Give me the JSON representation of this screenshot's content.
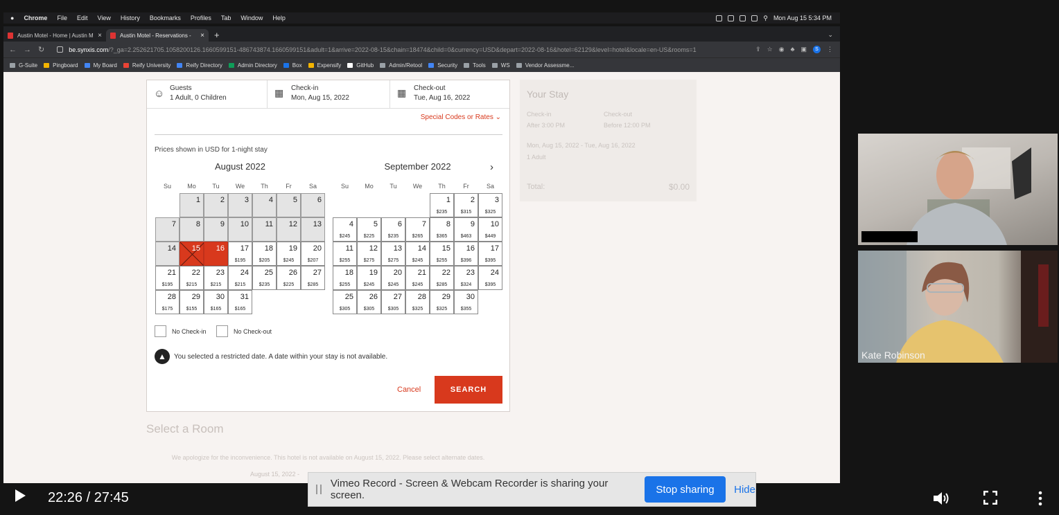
{
  "menubar": {
    "items": [
      "Chrome",
      "File",
      "Edit",
      "View",
      "History",
      "Bookmarks",
      "Profiles",
      "Tab",
      "Window",
      "Help"
    ],
    "clock": "Mon Aug 15  5:34 PM"
  },
  "tabs": [
    {
      "title": "Austin Motel - Home | Austin M"
    },
    {
      "title": "Austin Motel - Reservations - "
    }
  ],
  "address": {
    "domain": "be.synxis.com",
    "path": "/?_ga=2.252621705.1058200126.1660599151-486743874.1660599151&adult=1&arrive=2022-08-15&chain=18474&child=0&currency=USD&depart=2022-08-16&hotel=62129&level=hotel&locale=en-US&rooms=1"
  },
  "bookmarks": [
    "G-Suite",
    "Pingboard",
    "My Board",
    "Reify University",
    "Reify Directory",
    "Admin Directory",
    "Box",
    "Expensify",
    "GitHub",
    "Admin/Retool",
    "Security",
    "Tools",
    "WS",
    "Vendor Assessme..."
  ],
  "booking": {
    "guests_label": "Guests",
    "guests_value": "1 Adult, 0 Children",
    "checkin_label": "Check-in",
    "checkin_value": "Mon, Aug 15, 2022",
    "checkout_label": "Check-out",
    "checkout_value": "Tue, Aug 16, 2022",
    "special_codes": "Special Codes or Rates",
    "prices_note": "Prices shown in USD for 1-night stay",
    "weekdays": [
      "Su",
      "Mo",
      "Tu",
      "We",
      "Th",
      "Fr",
      "Sa"
    ],
    "months": [
      {
        "title": "August 2022",
        "first_weekday": 1,
        "days": [
          {
            "d": "1",
            "p": "",
            "s": "grey"
          },
          {
            "d": "2",
            "p": "",
            "s": "grey"
          },
          {
            "d": "3",
            "p": "",
            "s": "grey"
          },
          {
            "d": "4",
            "p": "",
            "s": "grey"
          },
          {
            "d": "5",
            "p": "",
            "s": "grey"
          },
          {
            "d": "6",
            "p": "",
            "s": "grey"
          },
          {
            "d": "7",
            "p": "",
            "s": "grey"
          },
          {
            "d": "8",
            "p": "",
            "s": "grey"
          },
          {
            "d": "9",
            "p": "",
            "s": "grey"
          },
          {
            "d": "10",
            "p": "",
            "s": "grey"
          },
          {
            "d": "11",
            "p": "",
            "s": "grey"
          },
          {
            "d": "12",
            "p": "",
            "s": "grey"
          },
          {
            "d": "13",
            "p": "",
            "s": "grey"
          },
          {
            "d": "14",
            "p": "",
            "s": "grey"
          },
          {
            "d": "15",
            "p": "",
            "s": "sel-x"
          },
          {
            "d": "16",
            "p": "",
            "s": "sel"
          },
          {
            "d": "17",
            "p": "$195",
            "s": ""
          },
          {
            "d": "18",
            "p": "$205",
            "s": ""
          },
          {
            "d": "19",
            "p": "$245",
            "s": ""
          },
          {
            "d": "20",
            "p": "$207",
            "s": ""
          },
          {
            "d": "21",
            "p": "$195",
            "s": ""
          },
          {
            "d": "22",
            "p": "$215",
            "s": ""
          },
          {
            "d": "23",
            "p": "$215",
            "s": ""
          },
          {
            "d": "24",
            "p": "$215",
            "s": ""
          },
          {
            "d": "25",
            "p": "$235",
            "s": ""
          },
          {
            "d": "26",
            "p": "$225",
            "s": ""
          },
          {
            "d": "27",
            "p": "$285",
            "s": ""
          },
          {
            "d": "28",
            "p": "$175",
            "s": ""
          },
          {
            "d": "29",
            "p": "$155",
            "s": ""
          },
          {
            "d": "30",
            "p": "$165",
            "s": ""
          },
          {
            "d": "31",
            "p": "$165",
            "s": ""
          }
        ]
      },
      {
        "title": "September 2022",
        "first_weekday": 4,
        "days": [
          {
            "d": "1",
            "p": "$235",
            "s": ""
          },
          {
            "d": "2",
            "p": "$315",
            "s": ""
          },
          {
            "d": "3",
            "p": "$325",
            "s": ""
          },
          {
            "d": "4",
            "p": "$245",
            "s": ""
          },
          {
            "d": "5",
            "p": "$225",
            "s": ""
          },
          {
            "d": "6",
            "p": "$235",
            "s": ""
          },
          {
            "d": "7",
            "p": "$265",
            "s": ""
          },
          {
            "d": "8",
            "p": "$365",
            "s": ""
          },
          {
            "d": "9",
            "p": "$463",
            "s": ""
          },
          {
            "d": "10",
            "p": "$449",
            "s": ""
          },
          {
            "d": "11",
            "p": "$255",
            "s": ""
          },
          {
            "d": "12",
            "p": "$275",
            "s": ""
          },
          {
            "d": "13",
            "p": "$275",
            "s": ""
          },
          {
            "d": "14",
            "p": "$245",
            "s": ""
          },
          {
            "d": "15",
            "p": "$255",
            "s": ""
          },
          {
            "d": "16",
            "p": "$396",
            "s": ""
          },
          {
            "d": "17",
            "p": "$395",
            "s": ""
          },
          {
            "d": "18",
            "p": "$255",
            "s": ""
          },
          {
            "d": "19",
            "p": "$245",
            "s": ""
          },
          {
            "d": "20",
            "p": "$245",
            "s": ""
          },
          {
            "d": "21",
            "p": "$245",
            "s": ""
          },
          {
            "d": "22",
            "p": "$285",
            "s": ""
          },
          {
            "d": "23",
            "p": "$324",
            "s": ""
          },
          {
            "d": "24",
            "p": "$395",
            "s": ""
          },
          {
            "d": "25",
            "p": "$305",
            "s": ""
          },
          {
            "d": "26",
            "p": "$305",
            "s": ""
          },
          {
            "d": "27",
            "p": "$305",
            "s": ""
          },
          {
            "d": "28",
            "p": "$325",
            "s": ""
          },
          {
            "d": "29",
            "p": "$325",
            "s": ""
          },
          {
            "d": "30",
            "p": "$355",
            "s": ""
          }
        ]
      }
    ],
    "no_checkin": "No Check-in",
    "no_checkout": "No Check-out",
    "warning": "You selected a restricted date.  A date within your stay is not available.",
    "cancel": "Cancel",
    "search": "SEARCH",
    "accent_color": "#d8391d"
  },
  "your_stay": {
    "title": "Your Stay",
    "checkin_label": "Check-in",
    "checkin_time": "After 3:00 PM",
    "checkout_label": "Check-out",
    "checkout_time": "Before 12:00 PM",
    "dates": "Mon, Aug 15, 2022 - Tue, Aug 16, 2022",
    "guests": "1 Adult",
    "total_label": "Total:",
    "total_value": "$0.00"
  },
  "select_room": {
    "title": "Select a Room",
    "apology": "We apologize for the inconvenience. This hotel is not available on August 15, 2022. Please select alternate dates.",
    "date": "August 15, 2022 -"
  },
  "webcam": {
    "participant_name": "Kate Robinson"
  },
  "player": {
    "time": "22:26 / 27:45"
  },
  "sharebar": {
    "message": "Vimeo Record - Screen & Webcam Recorder is sharing your screen.",
    "stop": "Stop sharing",
    "hide": "Hide"
  }
}
